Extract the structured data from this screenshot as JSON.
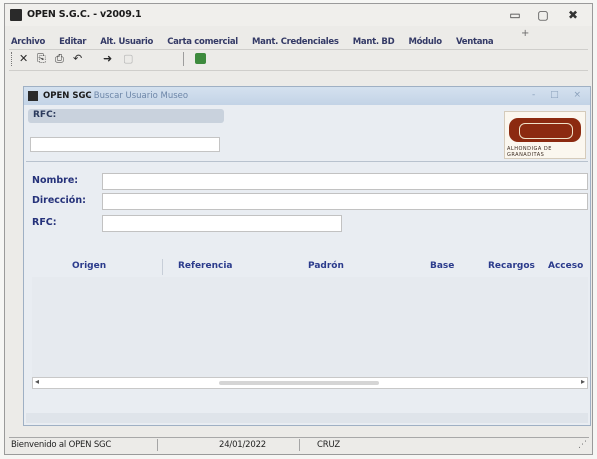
{
  "window": {
    "title": "OPEN S.G.C. - v2009.1",
    "minimize_glyph": "▭",
    "maximize_glyph": "▢",
    "close_glyph": "✖"
  },
  "menu": {
    "items": [
      {
        "label": "Archivo"
      },
      {
        "label": "Editar"
      },
      {
        "label": "Alt. Usuario"
      },
      {
        "label": "Carta comercial"
      },
      {
        "label": "Mant. Credenciales"
      },
      {
        "label": "Mant. BD"
      },
      {
        "label": "Módulo"
      },
      {
        "label": "Ventana"
      }
    ],
    "more_glyph": "+"
  },
  "toolbar": {
    "buttons": [
      {
        "icon": "close-icon",
        "glyph": "✕"
      },
      {
        "icon": "save-icon",
        "glyph": "⎘"
      },
      {
        "icon": "print-icon",
        "glyph": "⎙"
      },
      {
        "icon": "undo-icon",
        "glyph": "↶"
      },
      {
        "icon": "forward-icon",
        "glyph": "➜"
      },
      {
        "icon": "disabled-icon",
        "glyph": "▢"
      }
    ]
  },
  "form": {
    "title": "OPEN SGC",
    "subtitle": "- Buscar Usuario Museo",
    "window_buttons": "- □ ×",
    "rfc_group_label": "RFC:",
    "fields": [
      {
        "label": "Nombre:"
      },
      {
        "label": "Dirección:"
      },
      {
        "label": "RFC:"
      }
    ],
    "logo_caption": "ALHONDIGA DE GRANADITAS"
  },
  "grid": {
    "columns": [
      "Origen",
      "Referencia",
      "Padrón",
      "Base",
      "Recargos",
      "Acceso"
    ]
  },
  "scrollbar": {
    "left_glyph": "◂",
    "right_glyph": "▸"
  },
  "status": {
    "message": "Bienvenido al OPEN SGC",
    "date": "24/01/2022",
    "user": "CRUZ",
    "grip_glyph": "⋰"
  },
  "colors": {
    "menu_text": "#343a66",
    "field_label": "#25327a",
    "inner_title": "#c3d3e6",
    "logo_band": "#8c2a10"
  }
}
